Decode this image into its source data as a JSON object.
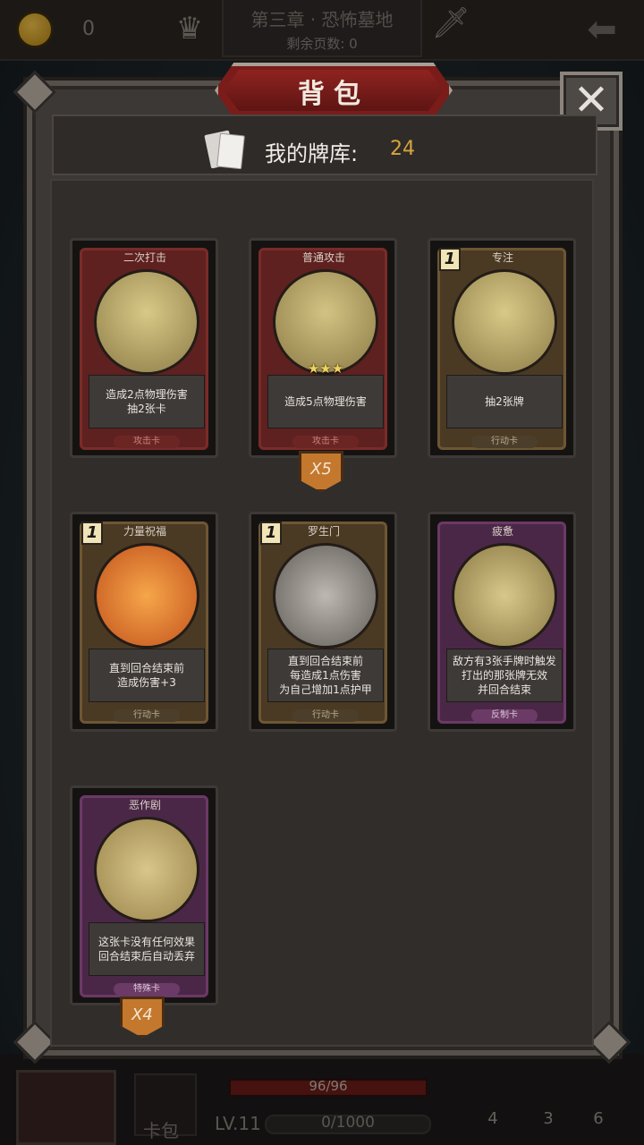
{
  "hud": {
    "coins": "0",
    "chapter_title": "第三章 · 恐怖墓地",
    "pages_left": "剩余页数: 0"
  },
  "bottom": {
    "hp": "96/96",
    "level": "LV.11",
    "xp": "0/1000",
    "deck_tab": "卡包",
    "stat_potion": "4",
    "stat_hourglass": "3",
    "stat_cards": "6"
  },
  "panel": {
    "title": "背包",
    "close": "✕",
    "deck_label": "我的牌库:",
    "deck_count": "24"
  },
  "cards": [
    {
      "name": "二次打击",
      "desc": "造成2点物理伤害\n抽2张卡",
      "type": "攻击卡",
      "cost": "",
      "count": ""
    },
    {
      "name": "普通攻击",
      "desc": "造成5点物理伤害",
      "type": "攻击卡",
      "cost": "",
      "count": "X5",
      "stars": "★★★"
    },
    {
      "name": "专注",
      "desc": "抽2张牌",
      "type": "行动卡",
      "cost": "1",
      "count": ""
    },
    {
      "name": "力量祝福",
      "desc": "直到回合结束前\n造成伤害+3",
      "type": "行动卡",
      "cost": "1",
      "count": ""
    },
    {
      "name": "罗生门",
      "desc": "直到回合结束前\n每造成1点伤害\n为自己增加1点护甲",
      "type": "行动卡",
      "cost": "1",
      "count": ""
    },
    {
      "name": "疲惫",
      "desc": "敌方有3张手牌时触发\n打出的那张牌无效\n并回合结束",
      "type": "反制卡",
      "cost": "",
      "count": ""
    },
    {
      "name": "恶作剧",
      "desc": "这张卡没有任何效果\n回合结束后自动丢弃",
      "type": "特殊卡",
      "cost": "",
      "count": "X4"
    }
  ],
  "colors": {
    "title_red": "#7a1c1a",
    "count_gold": "#d6a53c",
    "badge_orange": "#c3782e"
  }
}
